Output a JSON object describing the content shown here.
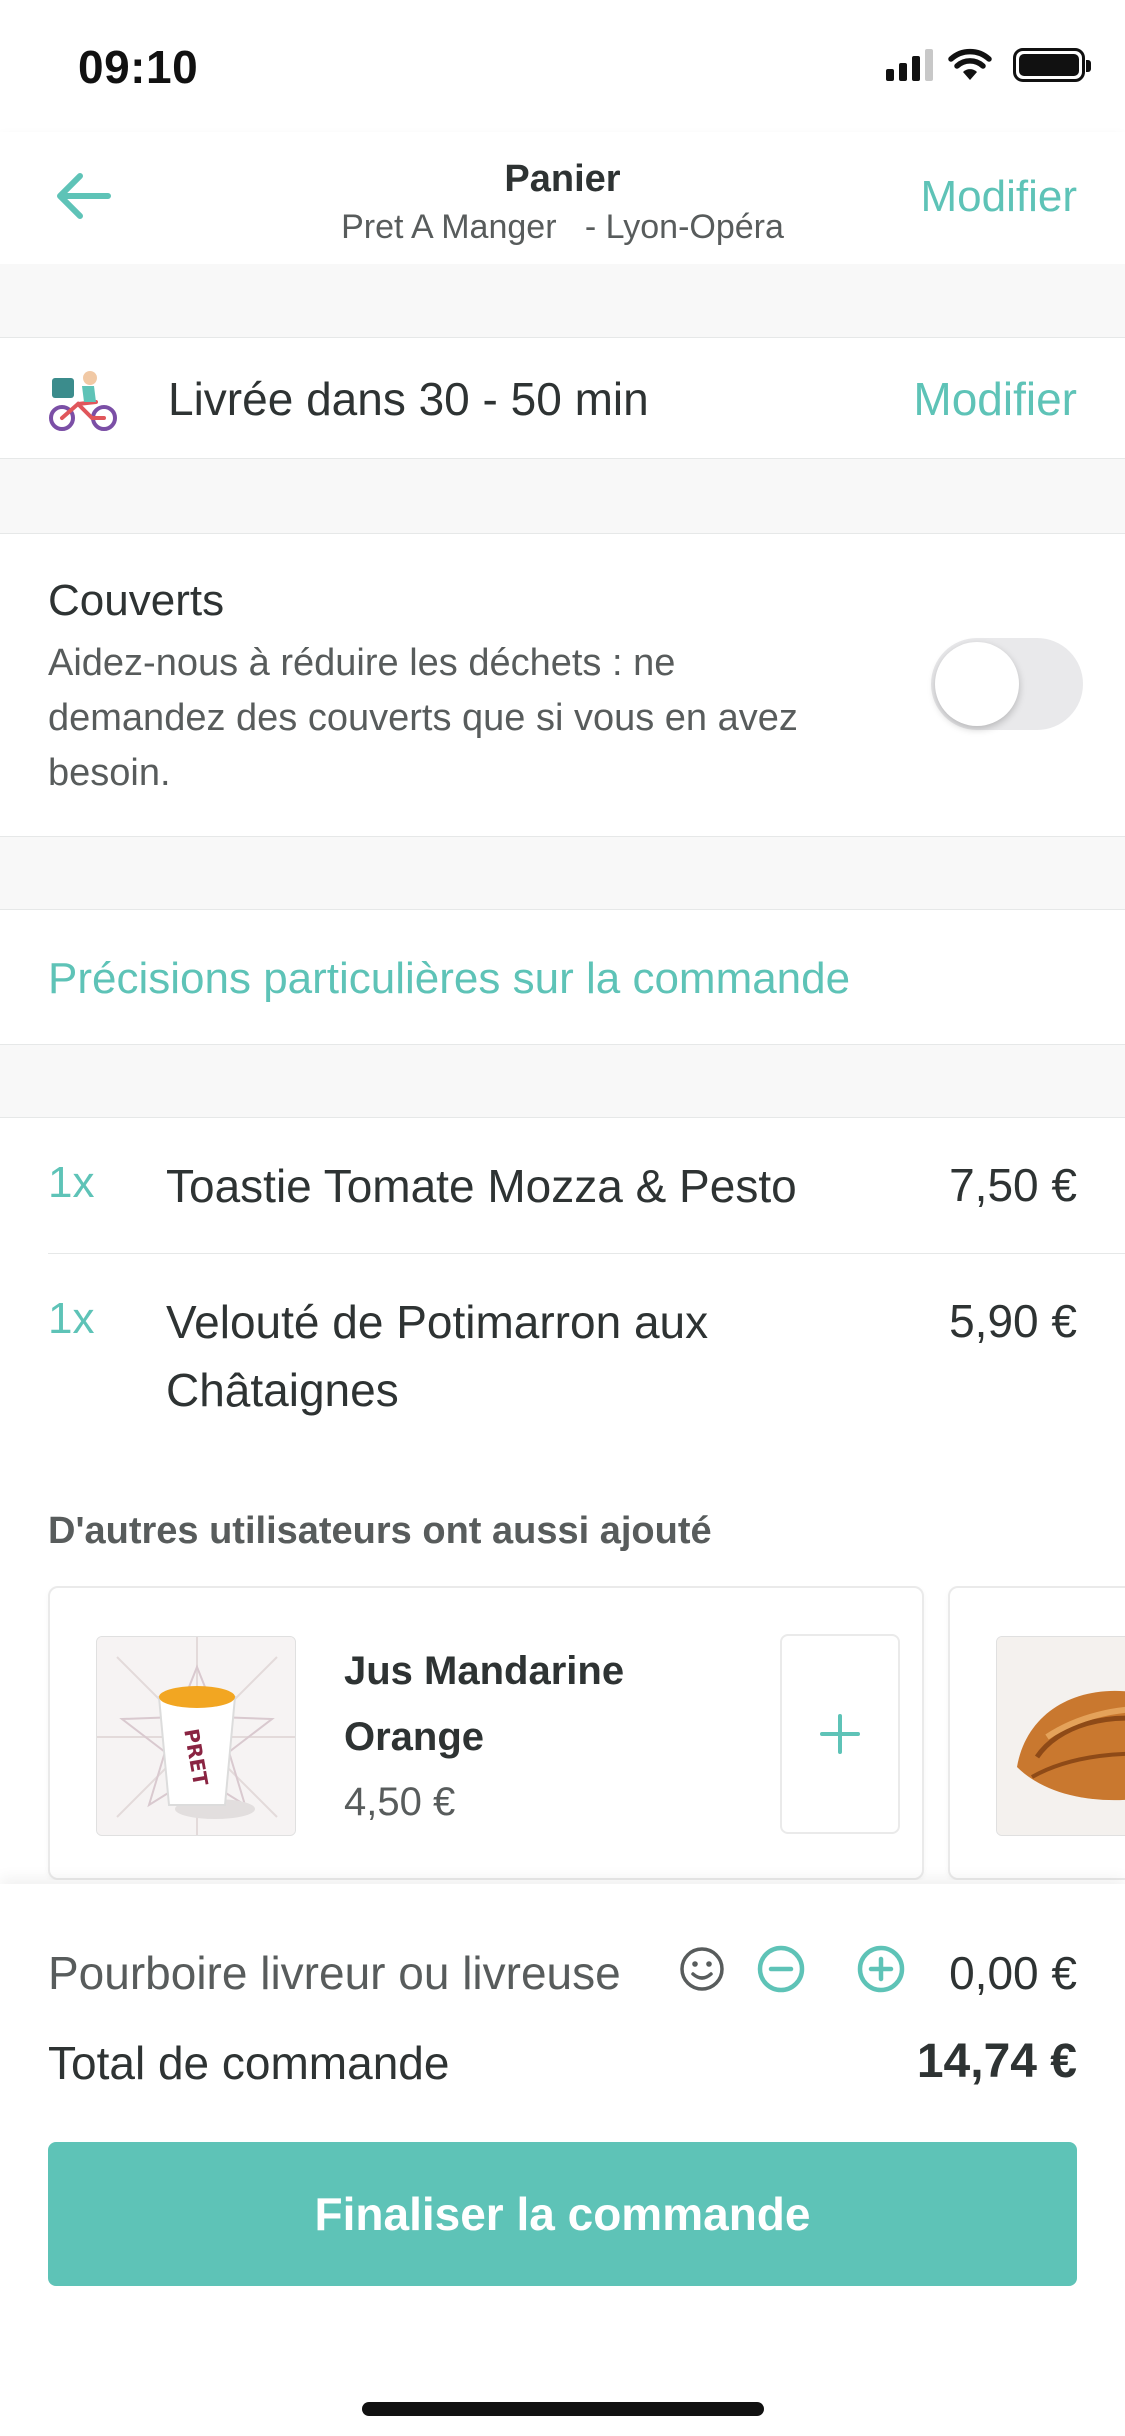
{
  "status_bar": {
    "time": "09:10"
  },
  "header": {
    "title": "Panier",
    "restaurant": "Pret A Manger   - Lyon-Opéra",
    "modify_label": "Modifier"
  },
  "delivery": {
    "text": "Livrée dans 30 - 50 min",
    "modify_label": "Modifier"
  },
  "cutlery": {
    "title": "Couverts",
    "description": "Aidez-nous à réduire les déchets : ne demandez des couverts que si vous en avez besoin.",
    "enabled": false
  },
  "special_requests": {
    "label": "Précisions particulières sur la commande"
  },
  "cart_items": [
    {
      "qty": "1x",
      "name": "Toastie Tomate Mozza & Pesto",
      "price": "7,50 €"
    },
    {
      "qty": "1x",
      "name": "Velouté de Potimarron aux Châtaignes",
      "price": "5,90 €"
    }
  ],
  "recommendations": {
    "title": "D'autres utilisateurs ont aussi ajouté",
    "items": [
      {
        "name": "Jus Mandarine Orange",
        "price": "4,50 €",
        "image": "juice-cup-image"
      },
      {
        "image": "croissant-image"
      }
    ]
  },
  "tip": {
    "label": "Pourboire livreur ou livreuse",
    "value": "0,00 €"
  },
  "total": {
    "label": "Total de commande",
    "value": "14,74 €"
  },
  "checkout": {
    "label": "Finaliser la commande"
  },
  "colors": {
    "accent": "#5ec3b7",
    "text": "#2e3333",
    "muted": "#585c5c",
    "background_gap": "#f8f8f8"
  }
}
